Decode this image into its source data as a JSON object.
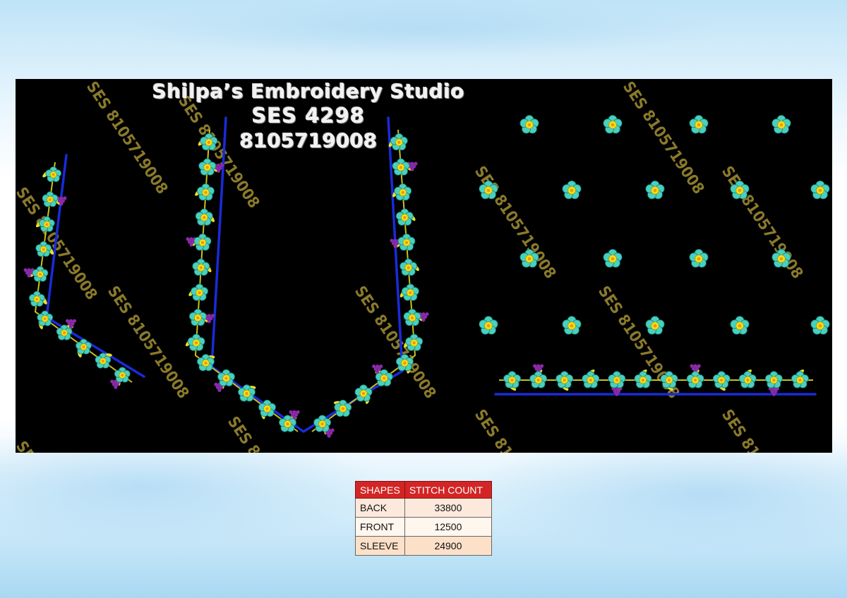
{
  "studio": {
    "name": "Shilpa’s Embroidery Studio",
    "code": "SES 4298",
    "phone": "8105719008"
  },
  "watermark": "SES 8105719008",
  "table": {
    "headers": [
      "SHAPES",
      "STITCH COUNT"
    ],
    "rows": [
      {
        "shape": "BACK",
        "count": "33800"
      },
      {
        "shape": "FRONT",
        "count": "12500"
      },
      {
        "shape": "SLEEVE",
        "count": "24900"
      }
    ]
  },
  "colors": {
    "background_panel": "#000000",
    "outline_blue": "#1a2bd8",
    "flower_teal": "#46d1c0",
    "flower_center": "#f5e21a",
    "leaf_yellow": "#e8e02a",
    "grape_purple": "#8a2aa8",
    "watermark_gold": "#8a7a2a",
    "table_header": "#d32525"
  }
}
